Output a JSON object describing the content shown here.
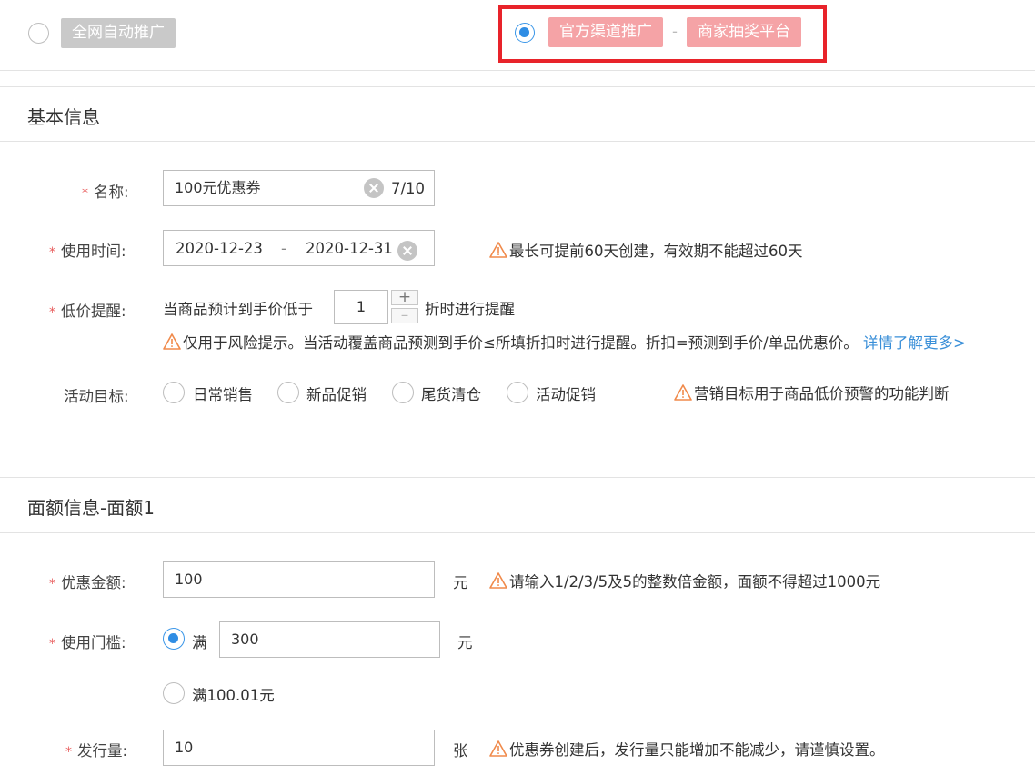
{
  "top": {
    "auto_promo_label": "全网自动推广",
    "official_channel_label": "官方渠道推广",
    "separator": "-",
    "lottery_label": "商家抽奖平台"
  },
  "basic": {
    "title": "基本信息",
    "name_label": "名称:",
    "name_value": "100元优惠券",
    "name_count": "7/10",
    "time_label": "使用时间:",
    "time_start": "2020-12-23",
    "time_sep": "-",
    "time_end": "2020-12-31",
    "time_warn": "最长可提前60天创建，有效期不能超过60天",
    "price_label": "低价提醒:",
    "price_prefix": "当商品预计到手价低于",
    "price_value": "1",
    "price_suffix": "折时进行提醒",
    "price_warn": "仅用于风险提示。当活动覆盖商品预测到手价≤所填折扣时进行提醒。折扣=预测到手价/单品优惠价。",
    "price_link": "详情了解更多>",
    "goal_label": "活动目标:",
    "goals": [
      "日常销售",
      "新品促销",
      "尾货清仓",
      "活动促销"
    ],
    "goal_warn": "营销目标用于商品低价预警的功能判断"
  },
  "amount": {
    "title": "面额信息-面额1",
    "discount_label": "优惠金额:",
    "discount_value": "100",
    "discount_unit": "元",
    "discount_warn": "请输入1/2/3/5及5的整数倍金额，面额不得超过1000元",
    "threshold_label": "使用门槛:",
    "threshold_full": "满",
    "threshold_value": "300",
    "threshold_unit": "元",
    "threshold_alt": "满100.01元",
    "issue_label": "发行量:",
    "issue_value": "10",
    "issue_unit": "张",
    "issue_warn": "优惠券创建后，发行量只能增加不能减少，请谨慎设置。"
  },
  "icons": {
    "warn_color": "#f08a4b",
    "accent": "#2f8de4",
    "highlight": "#e8232a"
  }
}
